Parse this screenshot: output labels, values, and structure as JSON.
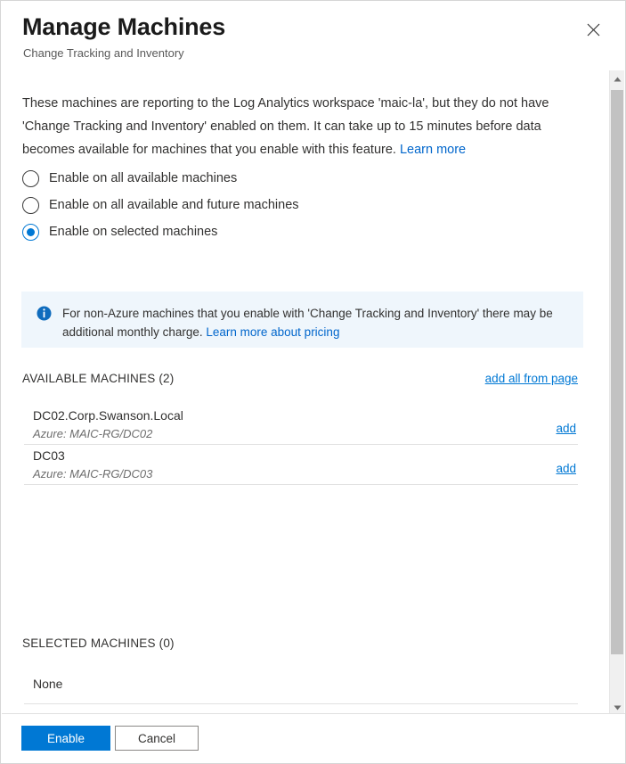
{
  "header": {
    "title": "Manage Machines",
    "subtitle": "Change Tracking and Inventory",
    "close_label": "Close"
  },
  "intro": {
    "text": "These machines are reporting to the Log Analytics workspace 'maic-la', but they do not have 'Change Tracking and Inventory' enabled on them. It can take up to 15 minutes before data becomes available for machines that you enable with this feature. ",
    "link_label": "Learn more"
  },
  "scope_options": [
    {
      "label": "Enable on all available machines",
      "selected": false
    },
    {
      "label": "Enable on all available and future machines",
      "selected": false
    },
    {
      "label": "Enable on selected machines",
      "selected": true
    }
  ],
  "info_banner": {
    "icon": "info-circle-icon",
    "text": "For non-Azure machines that you enable with 'Change Tracking and Inventory' there may be additional monthly charge. ",
    "link_label": "Learn more about pricing",
    "background_color": "#eff6fc",
    "icon_color": "#0078d4"
  },
  "available_section": {
    "title": "AVAILABLE MACHINES (2)",
    "action_label": "add all from page",
    "rows": [
      {
        "name": "DC02.Corp.Swanson.Local",
        "detail": "Azure: MAIC-RG/DC02",
        "action_label": "add"
      },
      {
        "name": "DC03",
        "detail": "Azure: MAIC-RG/DC03",
        "action_label": "add"
      }
    ]
  },
  "selected_section": {
    "title": "SELECTED MACHINES (0)",
    "empty_label": "None"
  },
  "scrollbar": {
    "up_icon": "caret-up-icon",
    "down_icon": "caret-down-icon"
  },
  "footer": {
    "primary_label": "Enable",
    "secondary_label": "Cancel",
    "primary_color": "#0078d4"
  }
}
